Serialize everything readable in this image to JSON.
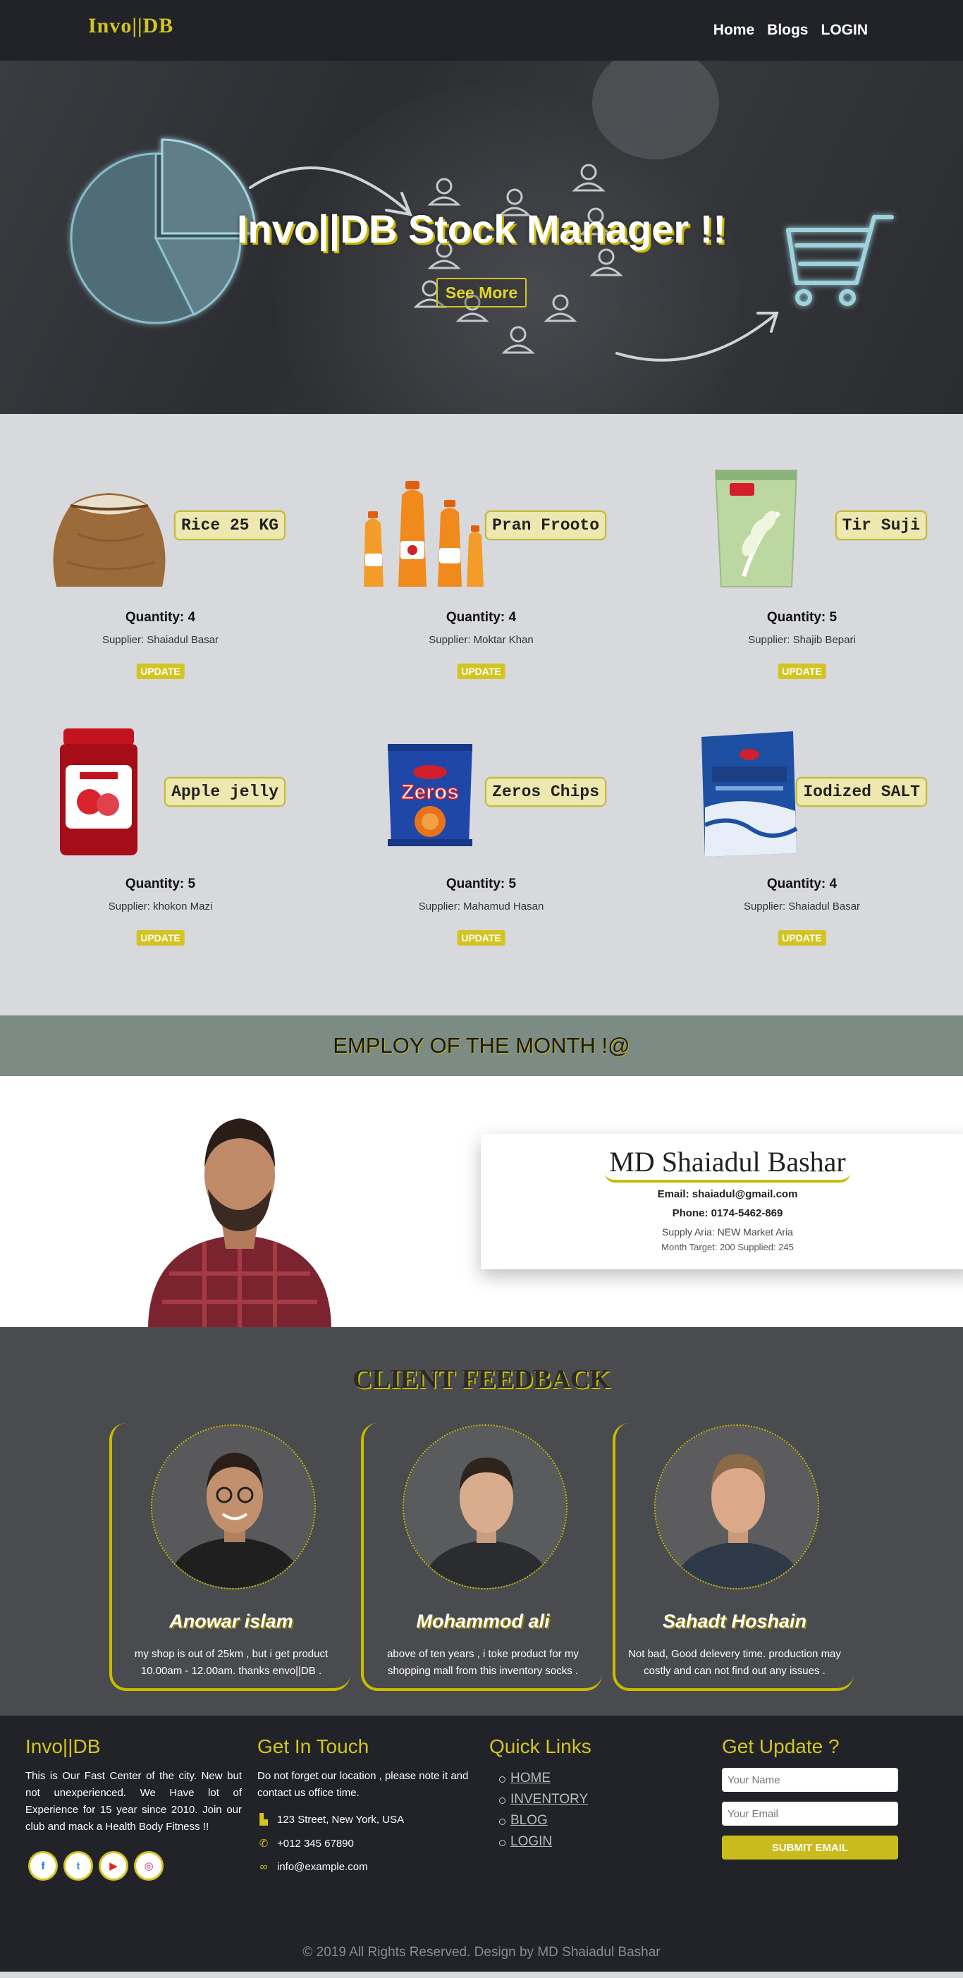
{
  "nav": {
    "brand": "Invo||DB",
    "links": [
      "Home",
      "Blogs",
      "LOGIN"
    ]
  },
  "hero": {
    "title": "Invo||DB Stock Manager !!",
    "button": "See More"
  },
  "products": [
    {
      "name": "Rice 25 KG",
      "quantity": "Quantity: 4",
      "supplier": "Supplier: Shaiadul Basar",
      "button": "UPDATE",
      "image": "rice-sack"
    },
    {
      "name": "Pran Frooto",
      "quantity": "Quantity: 4",
      "supplier": "Supplier: Moktar Khan",
      "button": "UPDATE",
      "image": "juice-bottles"
    },
    {
      "name": "Tir Suji",
      "quantity": "Quantity: 5",
      "supplier": "Supplier: Shajib Bepari",
      "button": "UPDATE",
      "image": "suji-pack"
    },
    {
      "name": "Apple jelly",
      "quantity": "Quantity: 5",
      "supplier": "Supplier: khokon Mazi",
      "button": "UPDATE",
      "image": "jelly-jar"
    },
    {
      "name": "Zeros Chips",
      "quantity": "Quantity: 5",
      "supplier": "Supplier: Mahamud Hasan",
      "button": "UPDATE",
      "image": "chips-pack"
    },
    {
      "name": "Iodized SALT",
      "quantity": "Quantity: 4",
      "supplier": "Supplier: Shaiadul Basar",
      "button": "UPDATE",
      "image": "salt-pack"
    }
  ],
  "employee": {
    "heading": "EMPLOY OF THE MONTH !@",
    "name": "MD Shaiadul Bashar",
    "email": "Email: shaiadul@gmail.com",
    "phone": "Phone: 0174-5462-869",
    "supply_area": "Supply Aria: NEW Market Aria",
    "target": "Month Target: 200 Supplied: 245"
  },
  "feedback": {
    "heading": "CLIENT FEEDBACK",
    "clients": [
      {
        "name": "Anowar islam",
        "text": "my shop is out of 25km , but i get product 10.00am - 12.00am. thanks envo||DB ."
      },
      {
        "name": "Mohammod ali",
        "text": "above of ten years , i toke product for my shopping mall from this inventory socks ."
      },
      {
        "name": "Sahadt Hoshain",
        "text": "Not bad, Good delevery time. production may costly and can not find out any issues ."
      }
    ]
  },
  "footer": {
    "about_title": "Invo||DB",
    "about_text": "This is Our Fast Center of the city. New but not unexperienced. We Have lot of Experience for 15 year since 2010. Join our club and mack a Health Body Fitness !!",
    "socials": [
      "f",
      "t",
      "▶",
      "◎"
    ],
    "contact_title": "Get In Touch",
    "contact_text": "Do not forget our location , please note it and contact us office time.",
    "address": "123 Street, New York, USA",
    "phone": "+012 345 67890",
    "email": "info@example.com",
    "links_title": "Quick Links",
    "links": [
      "HOME",
      "INVENTORY",
      "BLOG",
      "LOGIN"
    ],
    "update_title": "Get Update ?",
    "name_placeholder": "Your Name",
    "email_placeholder": "Your Email",
    "submit": "SUBMIT EMAIL",
    "copyright": "© 2019 All Rights Reserved. Design by MD Shaiadul Bashar"
  }
}
